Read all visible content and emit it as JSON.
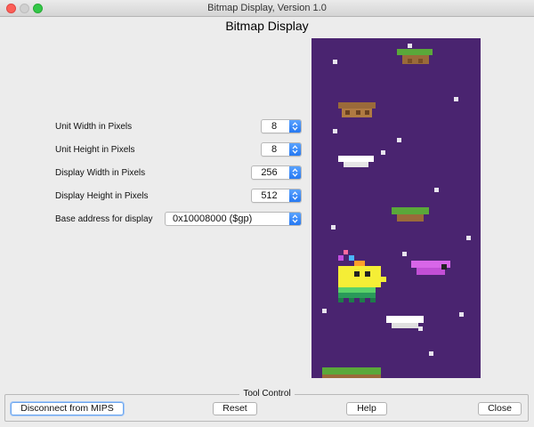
{
  "window": {
    "title": "Bitmap Display, Version 1.0"
  },
  "panel": {
    "title": "Bitmap Display"
  },
  "settings": {
    "unit_width": {
      "label": "Unit Width in Pixels",
      "value": "8"
    },
    "unit_height": {
      "label": "Unit Height in Pixels",
      "value": "8"
    },
    "display_width": {
      "label": "Display Width in Pixels",
      "value": "256"
    },
    "display_height": {
      "label": "Display Height in Pixels",
      "value": "512"
    },
    "base_address": {
      "label": "Base address for display",
      "value": "0x10008000 ($gp)"
    }
  },
  "tool_control": {
    "legend": "Tool Control",
    "disconnect_label": "Disconnect from MIPS",
    "reset_label": "Reset",
    "help_label": "Help",
    "close_label": "Close"
  },
  "colors": {
    "display_background": "#4a2470",
    "accent": "#2679f2"
  }
}
